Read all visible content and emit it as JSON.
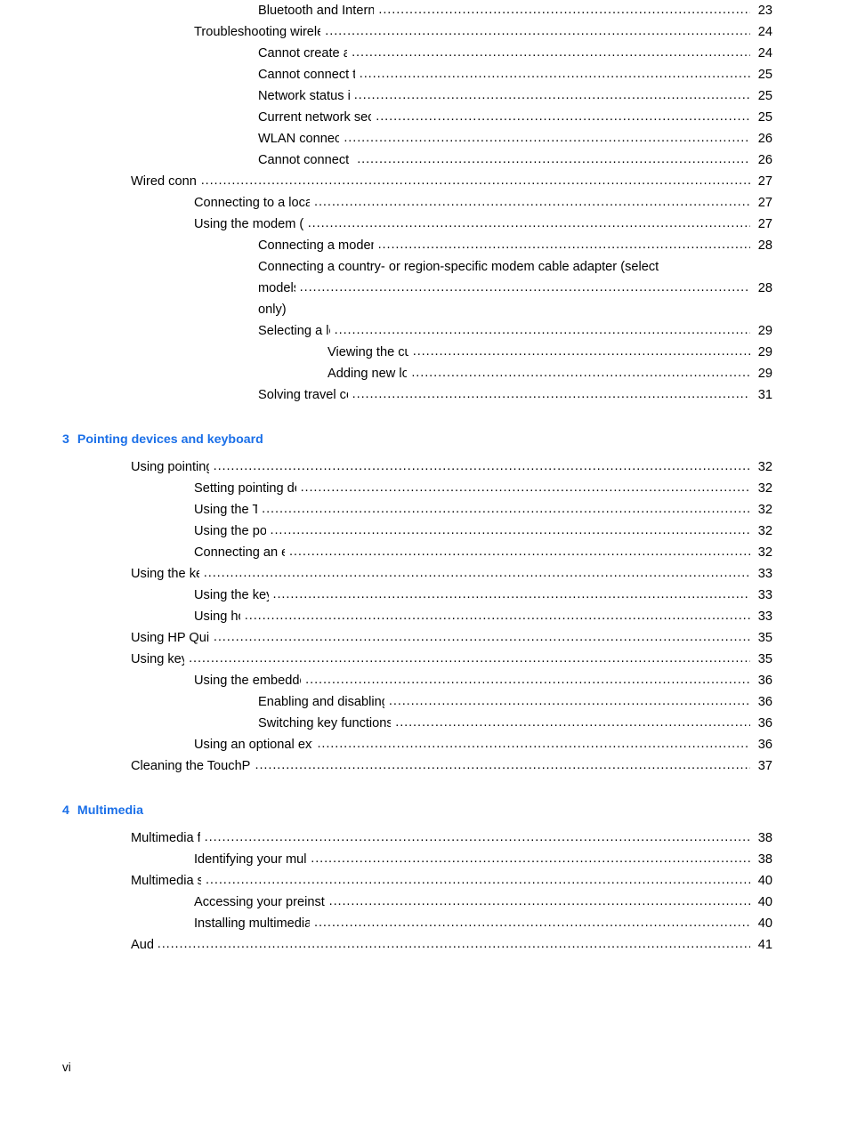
{
  "page": {
    "footer_page_number": "vi",
    "leader_dots": "...........................................................................................................................................................................................................",
    "accent_color": "#1a6fe8",
    "text_color": "#000000",
    "background_color": "#ffffff"
  },
  "blocks": [
    {
      "type": "entries",
      "items": [
        {
          "level": 3,
          "label": "Bluetooth and Internet Connection Sharing (ICS)",
          "page": "23"
        },
        {
          "level": 2,
          "label": "Troubleshooting wireless connection problems",
          "page": "24"
        },
        {
          "level": 3,
          "label": "Cannot create a WLAN connection",
          "page": "24"
        },
        {
          "level": 3,
          "label": "Cannot connect to a preferred network",
          "page": "25"
        },
        {
          "level": 3,
          "label": "Network status icon is not displayed",
          "page": "25"
        },
        {
          "level": 3,
          "label": "Current network security codes are unavailable",
          "page": "25"
        },
        {
          "level": 3,
          "label": "WLAN connection is very weak",
          "page": "26"
        },
        {
          "level": 3,
          "label": "Cannot connect to the wireless router",
          "page": "26"
        },
        {
          "level": 1,
          "label": "Wired connections",
          "page": "27"
        },
        {
          "level": 2,
          "label": "Connecting to a local area network (LAN)",
          "page": "27"
        },
        {
          "level": 2,
          "label": "Using the modem (select models only)",
          "page": "27"
        },
        {
          "level": 3,
          "label": "Connecting a modem cable (select models only)",
          "page": "28"
        },
        {
          "level": 3,
          "wrapped": true,
          "label_line1": "Connecting a country- or region-specific modem cable adapter (select",
          "label_line2": "models only)",
          "page": "28"
        },
        {
          "level": 3,
          "label": "Selecting a location setting",
          "page": "29"
        },
        {
          "level": 4,
          "label": "Viewing the current location selection",
          "page": "29"
        },
        {
          "level": 4,
          "label": "Adding new locations when traveling",
          "page": "29"
        },
        {
          "level": 3,
          "label": "Solving travel connection problems",
          "page": "31"
        }
      ]
    },
    {
      "type": "chapter",
      "number": "3",
      "title": "Pointing devices and keyboard"
    },
    {
      "type": "entries",
      "items": [
        {
          "level": 1,
          "label": "Using pointing devices",
          "page": "32"
        },
        {
          "level": 2,
          "label": "Setting pointing device preferences",
          "page": "32"
        },
        {
          "level": 2,
          "label": "Using the TouchPad",
          "page": "32"
        },
        {
          "level": 2,
          "label": "Using the pointing stick",
          "page": "32"
        },
        {
          "level": 2,
          "label": "Connecting an external mouse",
          "page": "32"
        },
        {
          "level": 1,
          "label": "Using the keyboard",
          "page": "33"
        },
        {
          "level": 2,
          "label": "Using the keyboard light",
          "page": "33"
        },
        {
          "level": 2,
          "label": "Using hotkeys",
          "page": "33"
        },
        {
          "level": 1,
          "label": "Using HP QuickLook 3",
          "page": "35"
        },
        {
          "level": 1,
          "label": "Using keypads",
          "page": "35"
        },
        {
          "level": 2,
          "label": "Using the embedded numeric keypad",
          "page": "36"
        },
        {
          "level": 3,
          "label": "Enabling and disabling the embedded numeric keypad",
          "page": "36"
        },
        {
          "level": 3,
          "label": "Switching key functions on the embedded numeric keypad",
          "page": "36"
        },
        {
          "level": 2,
          "label": "Using an optional external numeric keypad",
          "page": "36"
        },
        {
          "level": 1,
          "label": "Cleaning the TouchPad and keyboard",
          "page": "37"
        }
      ]
    },
    {
      "type": "chapter",
      "number": "4",
      "title": "Multimedia"
    },
    {
      "type": "entries",
      "items": [
        {
          "level": 1,
          "label": "Multimedia features",
          "page": "38"
        },
        {
          "level": 2,
          "label": "Identifying your multimedia components",
          "page": "38"
        },
        {
          "level": 1,
          "label": "Multimedia software",
          "page": "40"
        },
        {
          "level": 2,
          "label": "Accessing your preinstalled multimedia software",
          "page": "40"
        },
        {
          "level": 2,
          "label": "Installing multimedia software from a disc",
          "page": "40"
        },
        {
          "level": 1,
          "label": "Audio",
          "page": "41"
        }
      ]
    }
  ]
}
